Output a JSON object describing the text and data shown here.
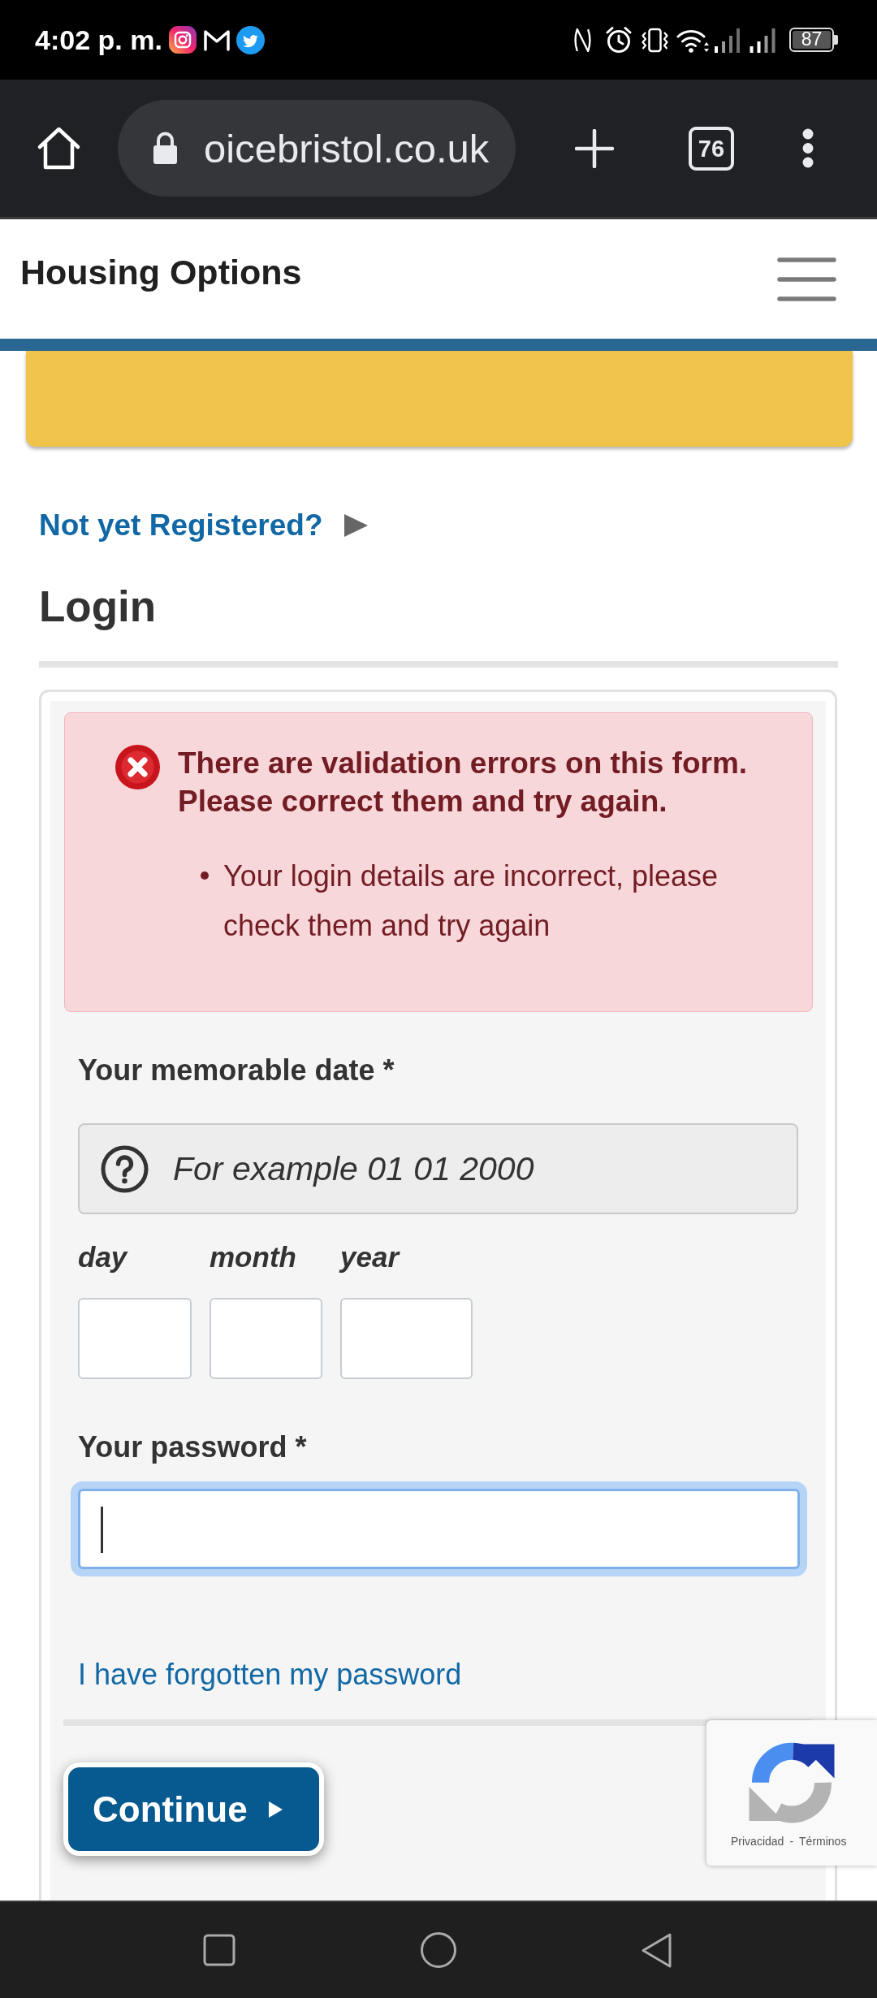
{
  "status_bar": {
    "time": "4:02 p. m.",
    "battery": "87"
  },
  "browser": {
    "url": "oicebristol.co.uk",
    "tab_count": "76"
  },
  "header": {
    "title": "Housing Options"
  },
  "register_link": {
    "label": "Not yet Registered?"
  },
  "heading": "Login",
  "form": {
    "error": {
      "title": "There are validation errors on this form. Please correct them and try again.",
      "items": [
        "Your login details are incorrect, please check them and try again"
      ]
    },
    "memorable_date": {
      "label": "Your memorable date *",
      "hint": "For example 01 01 2000",
      "parts": [
        {
          "label": "day"
        },
        {
          "label": "month"
        },
        {
          "label": "year"
        }
      ]
    },
    "password": {
      "label": "Your password *",
      "focused": true
    },
    "forgot_link": "I have forgotten my password",
    "submit": {
      "label": "Continue"
    }
  },
  "recaptcha": {
    "links": [
      "Privacidad",
      "Términos"
    ],
    "separator": "-"
  }
}
